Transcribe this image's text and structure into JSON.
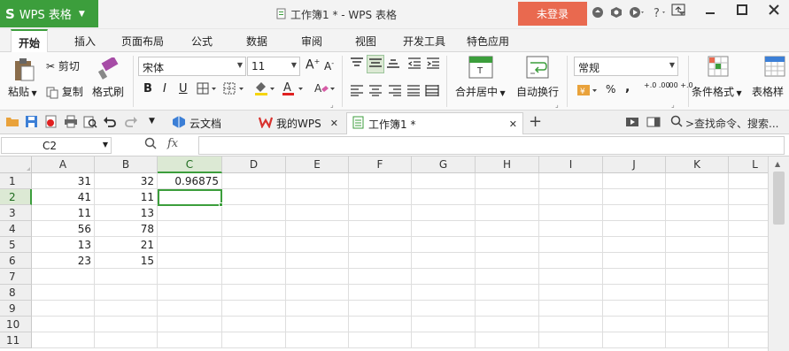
{
  "app": {
    "name": "WPS 表格",
    "logo": "S"
  },
  "title": "工作簿1 * - WPS 表格",
  "login_label": "未登录",
  "menu": [
    "开始",
    "插入",
    "页面布局",
    "公式",
    "数据",
    "审阅",
    "视图",
    "开发工具",
    "特色应用"
  ],
  "ribbon": {
    "paste": "粘贴",
    "cut": "剪切",
    "copy": "复制",
    "format_painter": "格式刷",
    "font_name": "宋体",
    "font_size": "11",
    "bold": "B",
    "italic": "I",
    "underline": "U",
    "font_color_letter": "A",
    "merge_center": "合并居中",
    "wrap_text": "自动换行",
    "number_format": "常规",
    "percent": "%",
    "comma": "⁹",
    "inc_decimal": "+.0 .00",
    "dec_decimal": ".00 +.0",
    "cond_format": "条件格式",
    "table_style": "表格样"
  },
  "tabs": [
    "云文档",
    "我的WPS",
    "工作簿1 *"
  ],
  "search_placeholder": ">查找命令、搜索...",
  "name_box": "C2",
  "fx": "fx",
  "columns": [
    "A",
    "B",
    "C",
    "D",
    "E",
    "F",
    "G",
    "H",
    "I",
    "J",
    "K",
    "L"
  ],
  "rows": [
    "1",
    "2",
    "3",
    "4",
    "5",
    "6",
    "7",
    "8",
    "9",
    "10",
    "11"
  ],
  "cells": [
    [
      "31",
      "32",
      "0.96875"
    ],
    [
      "41",
      "11",
      ""
    ],
    [
      "11",
      "13",
      ""
    ],
    [
      "56",
      "78",
      ""
    ],
    [
      "13",
      "21",
      ""
    ],
    [
      "23",
      "15",
      ""
    ]
  ],
  "colors": {
    "accent": "#3c9e3c",
    "login": "#e9694f"
  }
}
